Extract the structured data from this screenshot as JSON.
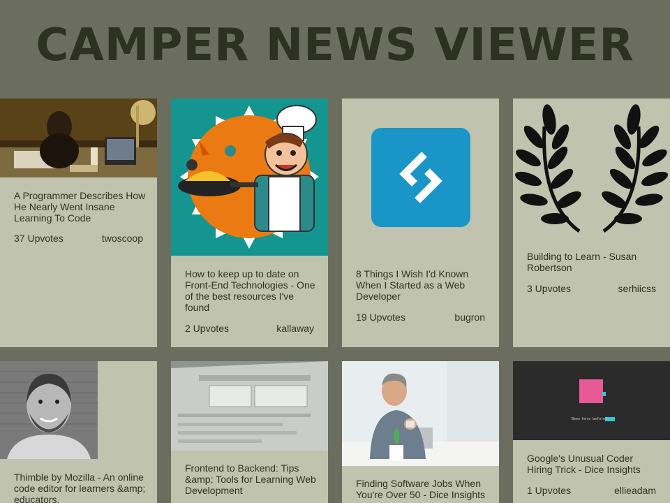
{
  "app": {
    "title": "CAMPER NEWS VIEWER"
  },
  "posts": [
    {
      "title": "A Programmer Describes How He Nearly Went Insane Learning To Code",
      "upvotes": "37 Upvotes",
      "author": "twoscoop",
      "image": "person-at-desk-photo"
    },
    {
      "title": "How to keep up to date on Front-End Technologies - One of the best resources I've found",
      "upvotes": "2 Upvotes",
      "author": "kallaway",
      "image": "chef-cartoon-illustration"
    },
    {
      "title": "8 Things I Wish I'd Known When I Started as a Web Developer",
      "upvotes": "19 Upvotes",
      "author": "bugron",
      "image": "blue-logo-icon"
    },
    {
      "title": "Building to Learn - Susan Robertson",
      "upvotes": "3 Upvotes",
      "author": "serhiicss",
      "image": "laurel-wreath-icon"
    },
    {
      "title": "Thimble by Mozilla - An online code editor for learners &amp; educators.",
      "upvotes": "",
      "author": "",
      "image": "man-portrait-photo"
    },
    {
      "title": "Frontend to Backend: Tips &amp; Tools for Learning Web Development",
      "upvotes": "",
      "author": "",
      "image": "screen-form-photo"
    },
    {
      "title": "Finding Software Jobs When You're Over 50 - Dice Insights",
      "upvotes": "",
      "author": "",
      "image": "man-with-laptop-photo"
    },
    {
      "title": "Google's Unusual Coder Hiring Trick - Dice Insights",
      "upvotes": "1 Upvotes",
      "author": "ellieadam",
      "image": "terminal-screen-image",
      "image_text": "Been here before?"
    }
  ],
  "colors": {
    "background": "#6b6e5e",
    "card": "#c0c3ad",
    "title": "#2d3220",
    "logo_blue": "#1a95c8"
  }
}
